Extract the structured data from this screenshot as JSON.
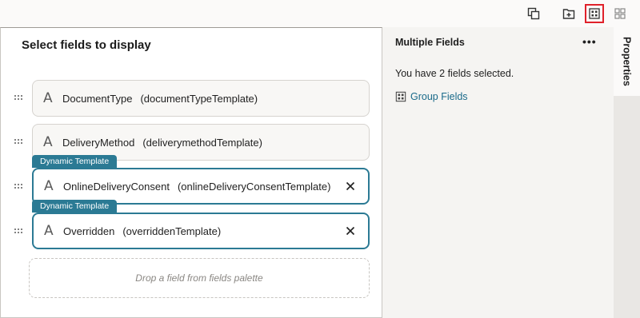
{
  "toolbar": {
    "buttons": [
      {
        "icon": "duplicate-icon",
        "selected": false
      },
      {
        "icon": "add-folder-icon",
        "selected": false
      },
      {
        "icon": "group-fields-icon",
        "selected": true
      },
      {
        "icon": "grid-layout-icon",
        "selected": false
      }
    ]
  },
  "canvas": {
    "title": "Select fields to display",
    "fields": [
      {
        "name": "DocumentType",
        "template": "(documentTypeTemplate)",
        "dynamic": false
      },
      {
        "name": "DeliveryMethod",
        "template": "(deliverymethodTemplate)",
        "dynamic": false
      },
      {
        "name": "OnlineDeliveryConsent",
        "template": "(onlineDeliveryConsentTemplate)",
        "dynamic": true,
        "badge": "Dynamic Template"
      },
      {
        "name": "Overridden",
        "template": "(overriddenTemplate)",
        "dynamic": true,
        "badge": "Dynamic Template"
      }
    ],
    "drop_placeholder": "Drop a field from fields palette"
  },
  "properties": {
    "title": "Multiple Fields",
    "more_label": "•••",
    "info": "You have 2 fields selected.",
    "group_link": "Group Fields"
  },
  "tabs": {
    "properties_label": "Properties"
  },
  "colors": {
    "accent": "#2b7a94",
    "link": "#1a6a8a",
    "selected_outline": "#e0212a"
  }
}
